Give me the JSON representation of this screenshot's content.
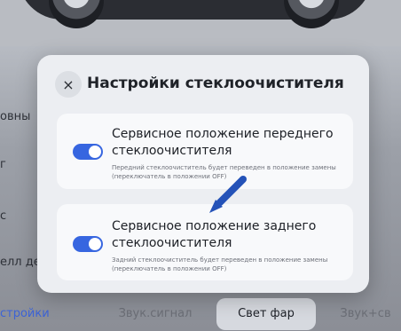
{
  "dialog": {
    "title": "Настройки стеклоочистителя",
    "close_glyph": "×",
    "cards": [
      {
        "title": "Сервисное положение переднего стеклоочистителя",
        "description": "Передний стеклоочиститель будет переведен в положение замены (переключатель в положении OFF)",
        "toggle_on": true
      },
      {
        "title": "Сервисное положение заднего стеклоочистителя",
        "description": "Задний стеклоочиститель будет переведен в положение замены (переключатель в положении OFF)",
        "toggle_on": true
      }
    ]
  },
  "background": {
    "side_fragments": [
      "овны",
      "г",
      "с",
      "елл дени",
      "стройки"
    ],
    "bottom_tabs": [
      "Звук.сигнал",
      "Свет фар",
      "Звук+св"
    ]
  },
  "colors": {
    "accent": "#3766e0",
    "dialog_bg": "#eceef2",
    "card_bg": "#f8f9fb"
  },
  "icons": {
    "close": "close-icon",
    "arrow": "arrow-pointer-icon"
  }
}
